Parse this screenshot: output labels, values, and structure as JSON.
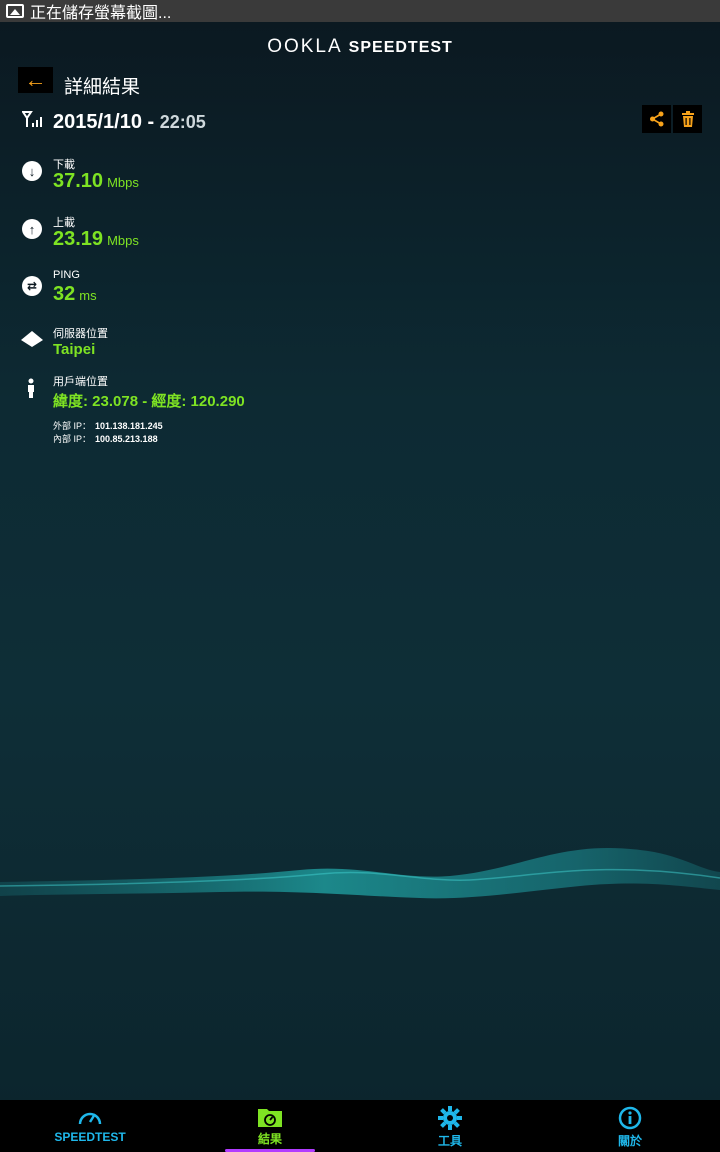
{
  "statusbar": {
    "text": "正在儲存螢幕截圖..."
  },
  "brand": {
    "ookla": "OOKLA",
    "speedtest": "SPEEDTEST"
  },
  "header": {
    "back_icon": "arrow-left-icon",
    "title": "詳細結果"
  },
  "result": {
    "date": "2015/1/10",
    "separator": "-",
    "time": "22:05",
    "share_icon": "share-icon",
    "delete_icon": "trash-icon"
  },
  "download": {
    "label": "下載",
    "value": "37.10",
    "unit": "Mbps"
  },
  "upload": {
    "label": "上載",
    "value": "23.19",
    "unit": "Mbps"
  },
  "ping": {
    "label": "PING",
    "value": "32",
    "unit": "ms"
  },
  "server": {
    "label": "伺服器位置",
    "value": "Taipei"
  },
  "client": {
    "label": "用戶端位置",
    "value": "緯度: 23.078 - 經度: 120.290"
  },
  "ip": {
    "external_label": "外部 IP：",
    "external_value": "101.138.181.245",
    "internal_label": "內部 IP：",
    "internal_value": "100.85.213.188"
  },
  "colors": {
    "accent_orange": "#f7a21b",
    "value_green": "#7ee323",
    "nav_blue": "#1fb7ea",
    "nav_active_bar": "#b23cff"
  },
  "nav": {
    "speedtest": "SPEEDTEST",
    "results": "結果",
    "tools": "工具",
    "about": "關於"
  }
}
